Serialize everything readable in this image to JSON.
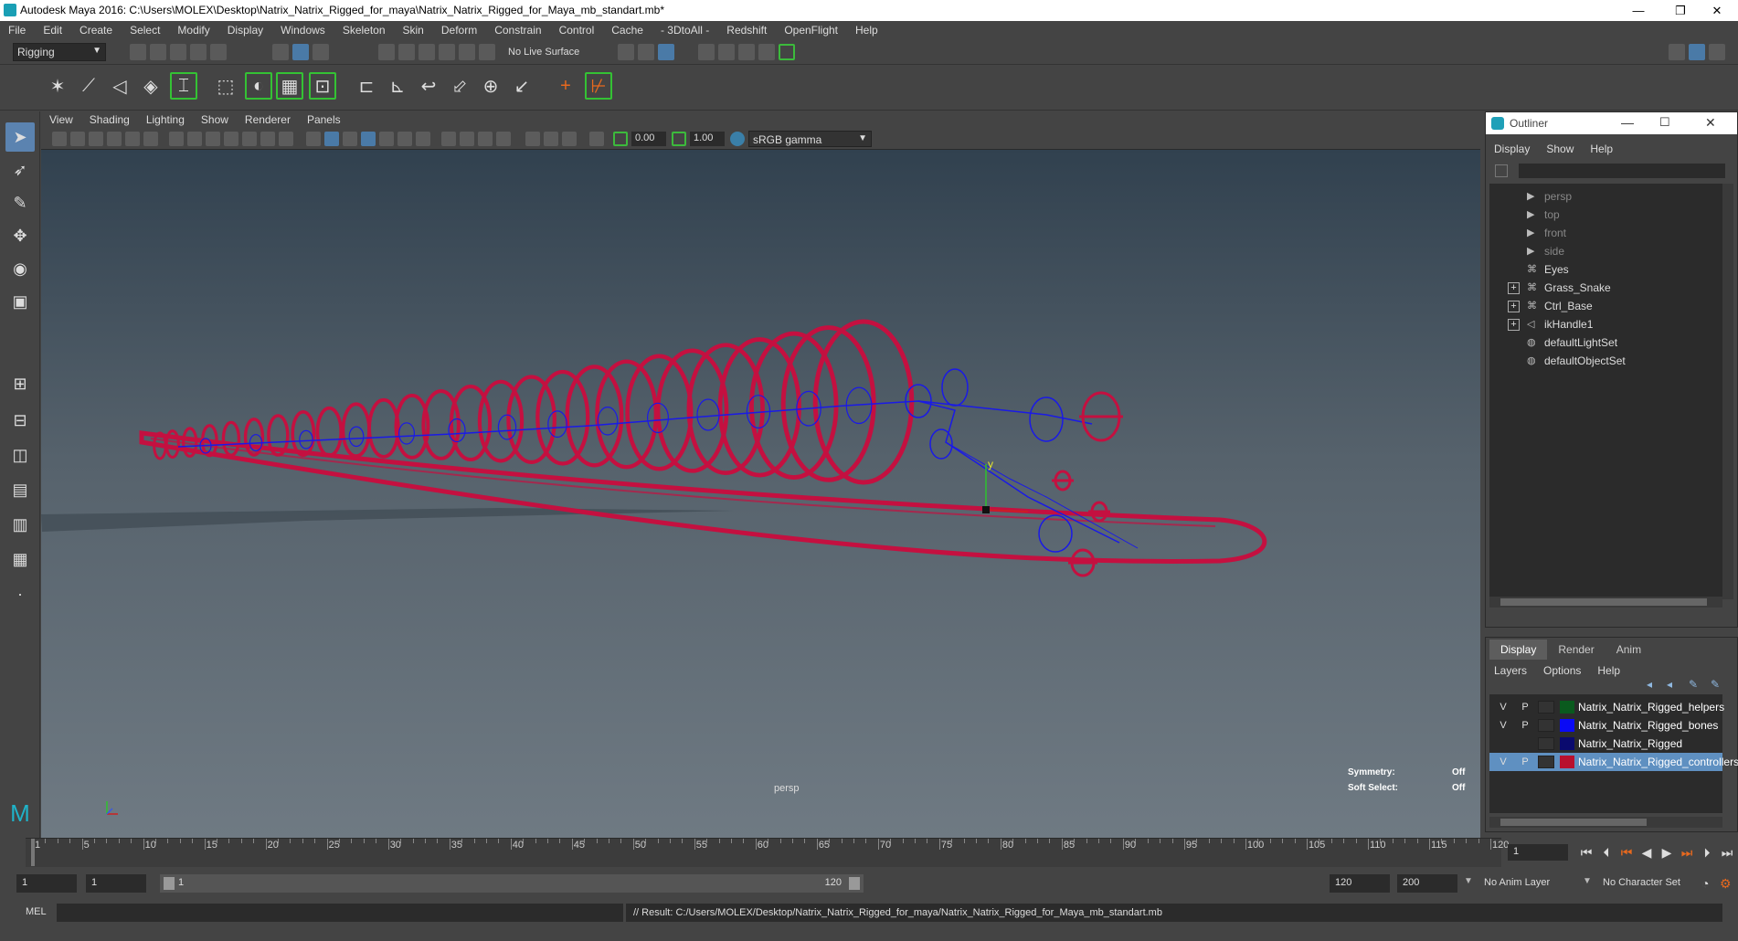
{
  "window": {
    "title": "Autodesk Maya 2016: C:\\Users\\MOLEX\\Desktop\\Natrix_Natrix_Rigged_for_maya\\Natrix_Natrix_Rigged_for_Maya_mb_standart.mb*",
    "minimize": "—",
    "restore": "❐",
    "close": "✕"
  },
  "menubar": [
    "File",
    "Edit",
    "Create",
    "Select",
    "Modify",
    "Display",
    "Windows",
    "Skeleton",
    "Skin",
    "Deform",
    "Constrain",
    "Control",
    "Cache",
    "- 3DtoAll -",
    "Redshift",
    "OpenFlight",
    "Help"
  ],
  "statusline": {
    "mode": "Rigging",
    "live_surface": "No Live Surface"
  },
  "viewport": {
    "menu": [
      "View",
      "Shading",
      "Lighting",
      "Show",
      "Renderer",
      "Panels"
    ],
    "exposure": "0.00",
    "gamma": "1.00",
    "color_space": "sRGB gamma",
    "camera": "persp",
    "hud": {
      "symmetry_label": "Symmetry:",
      "symmetry_value": "Off",
      "soft_select_label": "Soft Select:",
      "soft_select_value": "Off"
    },
    "axis_y": "y",
    "colors": {
      "controllers": "#c41040",
      "bones": "#1a1ae6"
    }
  },
  "outliner": {
    "title": "Outliner",
    "menu": [
      "Display",
      "Show",
      "Help"
    ],
    "items": [
      {
        "label": "persp",
        "icon": "camera-icon",
        "dim": true,
        "expandable": false
      },
      {
        "label": "top",
        "icon": "camera-icon",
        "dim": true,
        "expandable": false
      },
      {
        "label": "front",
        "icon": "camera-icon",
        "dim": true,
        "expandable": false
      },
      {
        "label": "side",
        "icon": "camera-icon",
        "dim": true,
        "expandable": false
      },
      {
        "label": "Eyes",
        "icon": "group-icon",
        "dim": false,
        "expandable": false
      },
      {
        "label": "Grass_Snake",
        "icon": "group-icon",
        "dim": false,
        "expandable": true
      },
      {
        "label": "Ctrl_Base",
        "icon": "group-icon",
        "dim": false,
        "expandable": true
      },
      {
        "label": "ikHandle1",
        "icon": "ik-handle-icon",
        "dim": false,
        "expandable": true
      },
      {
        "label": "defaultLightSet",
        "icon": "set-icon",
        "dim": false,
        "expandable": false
      },
      {
        "label": "defaultObjectSet",
        "icon": "set-icon",
        "dim": false,
        "expandable": false
      }
    ]
  },
  "layer_editor": {
    "tabs": [
      "Display",
      "Render",
      "Anim"
    ],
    "active_tab": "Display",
    "menu": [
      "Layers",
      "Options",
      "Help"
    ],
    "layers": [
      {
        "v": "V",
        "p": "P",
        "color": "#0a5a1e",
        "name": "Natrix_Natrix_Rigged_helpers",
        "selected": false
      },
      {
        "v": "V",
        "p": "P",
        "color": "#0a0af5",
        "name": "Natrix_Natrix_Rigged_bones",
        "selected": false
      },
      {
        "v": "",
        "p": "",
        "color": "#0a0a6e",
        "name": "Natrix_Natrix_Rigged",
        "selected": false
      },
      {
        "v": "V",
        "p": "P",
        "color": "#b8102e",
        "name": "Natrix_Natrix_Rigged_controllers",
        "selected": true
      }
    ]
  },
  "timeslider": {
    "ticks": [
      "1",
      "5",
      "10",
      "15",
      "20",
      "25",
      "30",
      "35",
      "40",
      "45",
      "50",
      "55",
      "60",
      "65",
      "70",
      "75",
      "80",
      "85",
      "90",
      "95",
      "100",
      "105",
      "110",
      "115",
      "120"
    ],
    "current_frame": "1"
  },
  "rangeslider": {
    "start": "1",
    "playback_start": "1",
    "range_start": "1",
    "range_end": "120",
    "playback_end": "120",
    "end": "200",
    "anim_layer": "No Anim Layer",
    "character_set": "No Character Set"
  },
  "cmdline": {
    "label": "MEL",
    "result": "// Result: C:/Users/MOLEX/Desktop/Natrix_Natrix_Rigged_for_maya/Natrix_Natrix_Rigged_for_Maya_mb_standart.mb"
  }
}
